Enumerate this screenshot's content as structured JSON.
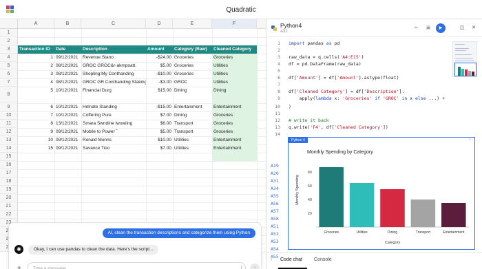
{
  "app": {
    "title": "Quadratic",
    "logo_colors": [
      "#cf3a6f",
      "#3f58d8",
      "#e0b34a",
      "#56b26d"
    ]
  },
  "sheet": {
    "columns": [
      "A",
      "B",
      "C",
      "D",
      "E",
      "F"
    ],
    "rows": [
      "1",
      "2",
      "3",
      "4",
      "5",
      "6",
      "7",
      "8",
      "9",
      "10",
      "11",
      "12",
      "13",
      "14",
      "15",
      "16",
      "17",
      "18",
      "19",
      "20",
      "21",
      "22",
      "23",
      "24",
      "25",
      "26"
    ],
    "header": [
      "Transaction ID",
      "Date",
      "Description",
      "Amount",
      "Category (Raw)",
      "Cleaned Category"
    ],
    "data": [
      [
        "1",
        "09/12/2021",
        "Revenue Stano",
        "-$24.00",
        "Groceries",
        "Groceries"
      ],
      [
        "2",
        "08/12/2021",
        "GROC GROC&r-akmpoatt.",
        "$5.00",
        "Groceries",
        "Utilities"
      ],
      [
        "3",
        "08/12/2021",
        "Shopling:My Conthanding",
        "-$10.00",
        "Groceries",
        "Utilities"
      ],
      [
        "4",
        "08/12/2021",
        "GROC GR Conthanding Staking",
        "-$3.00",
        "GROC",
        "Utilities"
      ],
      [
        "5",
        "10/12/2021",
        "Financial Durg",
        "$15.00",
        "Dining",
        "Dining"
      ],
      [
        "6",
        "10/12/2021",
        "Hnlnate Standing",
        "-$15.00",
        "Entertainment",
        "Entertainment"
      ],
      [
        "7",
        "10/12/2021",
        "Coffering Pure",
        "$7.00",
        "Dining",
        "Groceries"
      ],
      [
        "8",
        "13/12/2021",
        "Smara Swndine lwowiing",
        "$6.00",
        "Transport",
        "Groceries"
      ],
      [
        "9",
        "09/12/2021",
        "Mobile to Power ˜",
        "$5.00",
        "Transport",
        "Groceries"
      ],
      [
        "10",
        "09/12/2021",
        "Ronald Monns",
        "$10.00",
        "Utilities",
        "Entertainment"
      ],
      [
        "15",
        "09/12/2021",
        "Savance Tioo",
        "$7.00",
        "Utilities",
        "Entertainment"
      ]
    ]
  },
  "chat": {
    "user_message": "AI, clean the transaction descriptions and categorize them using Python",
    "ai_message": "Okay, I can use pandas to clean the data. Here's the script...",
    "input_placeholder": "Type a message...",
    "plus_label": "+",
    "send_label": "↑"
  },
  "code_panel": {
    "title": "Python4",
    "cell_ref": "A31",
    "line_numbers": [
      "1",
      "2",
      "3",
      "4",
      "5",
      "6",
      "7",
      "8",
      "9",
      "10",
      "11",
      "12",
      "13",
      "14"
    ],
    "lines": [
      [
        {
          "t": "import",
          "c": "kw"
        },
        {
          "t": " pandas "
        },
        {
          "t": "as",
          "c": "kw"
        },
        {
          "t": " pd"
        }
      ],
      [
        {
          "t": ""
        }
      ],
      [
        {
          "t": "raw_data = q.cells("
        },
        {
          "t": "'A4:E15'",
          "c": "str"
        },
        {
          "t": ")"
        }
      ],
      [
        {
          "t": "df = pd.DataFrame(raw_data)"
        }
      ],
      [
        {
          "t": ""
        }
      ],
      [
        {
          "t": "df["
        },
        {
          "t": "'Amount'",
          "c": "str"
        },
        {
          "t": "] = df["
        },
        {
          "t": "'Amount'",
          "c": "str"
        },
        {
          "t": "].astype(float)"
        }
      ],
      [
        {
          "t": ""
        }
      ],
      [
        {
          "t": "df["
        },
        {
          "t": "'Cleaned Category'",
          "c": "str"
        },
        {
          "t": "] = df["
        },
        {
          "t": "'Description'",
          "c": "str"
        },
        {
          "t": "]."
        }
      ],
      [
        {
          "t": "    apply("
        },
        {
          "t": "lambda",
          "c": "kw"
        },
        {
          "t": " x: "
        },
        {
          "t": "'Groceries'",
          "c": "str"
        },
        {
          "t": " "
        },
        {
          "t": "if",
          "c": "kw"
        },
        {
          "t": " "
        },
        {
          "t": "'GROC'",
          "c": "str"
        },
        {
          "t": " "
        },
        {
          "t": "in",
          "c": "kw"
        },
        {
          "t": " x "
        },
        {
          "t": "else",
          "c": "kw"
        },
        {
          "t": " ...) +"
        }
      ],
      [
        {
          "t": ")"
        }
      ],
      [
        {
          "t": ""
        }
      ],
      [
        {
          "t": "# write it back",
          "c": "cm"
        }
      ],
      [
        {
          "t": "q.write("
        },
        {
          "t": "'F4'",
          "c": "str"
        },
        {
          "t": ", df["
        },
        {
          "t": "'Cleaned Category'",
          "c": "str"
        },
        {
          "t": "])"
        }
      ],
      [
        {
          "t": ""
        }
      ]
    ],
    "ref_labels": [
      "A19",
      "A20",
      "A31",
      "A34",
      "A55",
      "A56",
      "A57",
      "A58",
      "A51",
      "A52",
      "A53",
      "A54",
      "A55"
    ],
    "output_tab": "Python 4",
    "tabs": [
      "Code chat",
      "Console"
    ]
  },
  "chart_data": {
    "type": "bar",
    "title": "Monthly Spending by Category",
    "xlabel": "Category",
    "ylabel": "Monthly Spending",
    "categories": [
      "Groceries",
      "Utilities",
      "Dining",
      "Transport",
      "Entertainment"
    ],
    "values": [
      87,
      64,
      55,
      40,
      35
    ],
    "colors": [
      "#1f7b77",
      "#2fbdb9",
      "#d52942",
      "#a4a4a4",
      "#5a1d3c"
    ],
    "yticks": [
      20,
      40,
      60,
      80
    ],
    "ylim": [
      0,
      100
    ],
    "grid": false,
    "legend": "none"
  }
}
